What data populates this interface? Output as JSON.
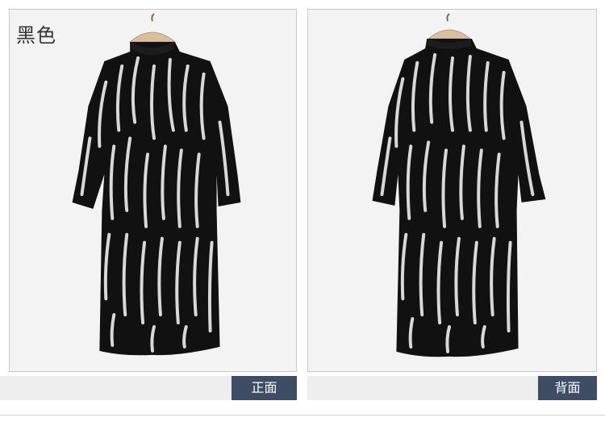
{
  "color_label": "黑色",
  "views": {
    "front": {
      "label": "正面"
    },
    "back": {
      "label": "背面"
    }
  },
  "colors": {
    "panel_bg": "#f3f3f3",
    "garment": "#111111",
    "pattern": "#d8d8d8",
    "tag_bg": "#3d4d65",
    "tag_text": "#ffffff"
  }
}
